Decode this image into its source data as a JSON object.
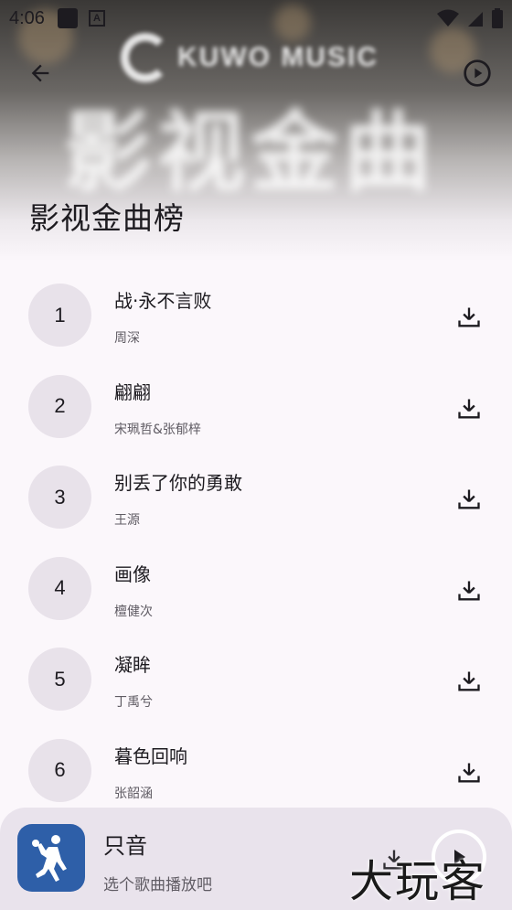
{
  "status_bar": {
    "time": "4:06",
    "icons": [
      "notification-square-icon",
      "a-badge-icon",
      "wifi-icon",
      "signal-icon",
      "battery-icon"
    ]
  },
  "banner": {
    "logo_text": "KUWO MUSIC",
    "big_text": "影视金曲"
  },
  "header": {
    "back_icon": "arrow-left-icon",
    "play_icon": "play-circle-icon",
    "title": "影视金曲榜"
  },
  "songs": [
    {
      "rank": "1",
      "title": "战·永不言败",
      "artist": "周深"
    },
    {
      "rank": "2",
      "title": "翩翩",
      "artist": "宋珮哲&张郁梓"
    },
    {
      "rank": "3",
      "title": "别丢了你的勇敢",
      "artist": "王源"
    },
    {
      "rank": "4",
      "title": "画像",
      "artist": "檀健次"
    },
    {
      "rank": "5",
      "title": "凝眸",
      "artist": "丁禹兮"
    },
    {
      "rank": "6",
      "title": "暮色回响",
      "artist": "张韶涵"
    }
  ],
  "player": {
    "title": "只音",
    "subtitle": "选个歌曲播放吧"
  },
  "watermark": "大玩客",
  "colors": {
    "rank_bg": "#e8e2ea",
    "player_bg": "#e9e3ec",
    "cover_bg": "#2e5fa8"
  }
}
